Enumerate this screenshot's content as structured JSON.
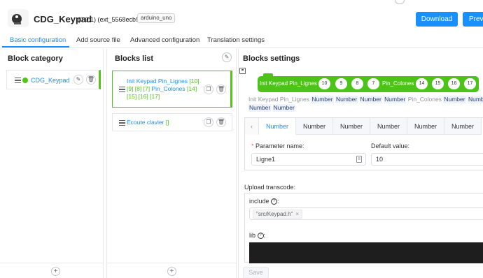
{
  "header": {
    "title": "CDG_Keypad",
    "version": "(0.0.1) (ext_5568ecb9)",
    "board": "arduino_uno",
    "download_label": "Download",
    "preview_label": "Previ"
  },
  "tabs": [
    {
      "label": "Basic configuration",
      "active": true
    },
    {
      "label": "Add source file",
      "active": false
    },
    {
      "label": "Advanced configuration",
      "active": false
    },
    {
      "label": "Translation settings",
      "active": false
    }
  ],
  "block_category": {
    "title": "Block category",
    "items": [
      {
        "label": "CDG_Keypad",
        "color": "#52c41a"
      }
    ]
  },
  "blocks_list": {
    "title": "Blocks list",
    "items": [
      {
        "line1_a": "Init Keypad Pin_Lignes ",
        "line1_b": "[10]",
        "line2_a": "[9] [8] [7]",
        "line2_b": " Pin_Colones ",
        "line2_c": "[14]",
        "line3_a": "[15] [16] [17]",
        "selected": true
      },
      {
        "label_a": "Ecoute clavier ",
        "label_b": "[]",
        "selected": false
      }
    ]
  },
  "blocks_settings": {
    "title": "Blocks settings",
    "preview": {
      "label_init": "Init Keypad Pin_Lignes",
      "label_cols": "Pin_Colones",
      "line_pins": [
        "10",
        "9",
        "8",
        "7"
      ],
      "col_pins": [
        "14",
        "15",
        "16",
        "17"
      ],
      "color": "#4cc417"
    },
    "sentence": {
      "prefix": "Init Keypad Pin_Lignes",
      "number": "Number",
      "middle": "Pin_Colones"
    },
    "param_tabs": [
      "Number",
      "Number",
      "Number",
      "Number",
      "Number",
      "Number"
    ],
    "parameter_name_label": "Parameter name:",
    "parameter_name_value": "Ligne1",
    "default_value_label": "Default value:",
    "default_value_value": "10",
    "upload_transcode_label": "Upload transcode:",
    "include_label": "include",
    "include_chip": "\"src/Keypad.h\"",
    "lib_label": "lib",
    "save_label": "Save"
  },
  "colors": {
    "accent": "#1890ff",
    "block_green": "#52c41a"
  }
}
